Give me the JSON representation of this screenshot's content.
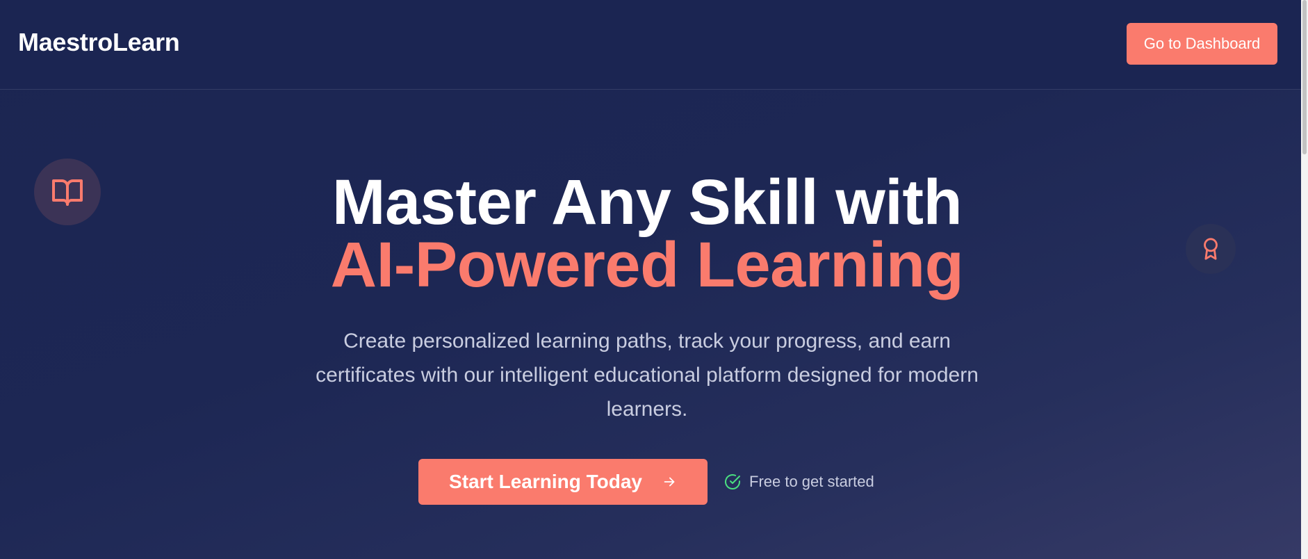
{
  "header": {
    "brand": "MaestroLearn",
    "dashboard_button": "Go to Dashboard"
  },
  "hero": {
    "title_line1": "Master Any Skill with",
    "title_line2": "AI-Powered Learning",
    "subtitle": "Create personalized learning paths, track your progress, and earn certificates with our intelligent educational platform designed for modern learners.",
    "cta_label": "Start Learning Today",
    "free_note": "Free to get started"
  },
  "icons": {
    "book": "book-open-icon",
    "award": "award-icon",
    "arrow": "arrow-right-icon",
    "check": "check-circle-icon"
  },
  "colors": {
    "background": "#1b2552",
    "accent": "#fa7b6d",
    "check_green": "#4ade80",
    "muted_text": "#c9cde0"
  }
}
